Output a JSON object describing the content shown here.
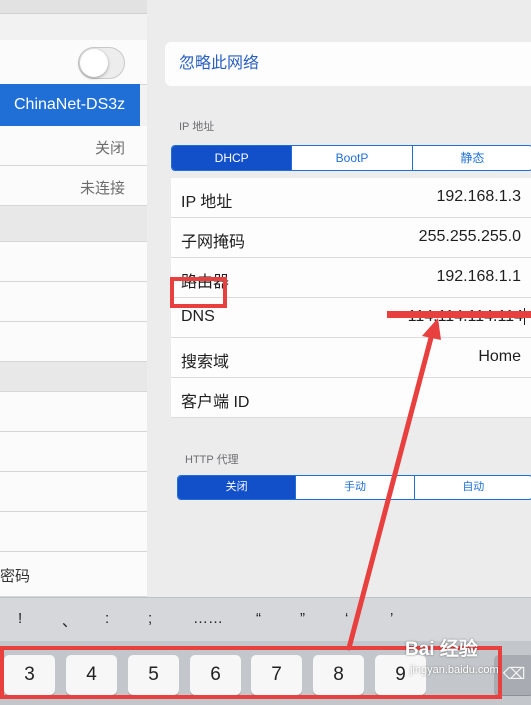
{
  "left_pane": {
    "selected_network": "ChinaNet-DS3z",
    "row1_value": "关闭",
    "row2_value": "未连接",
    "bottom_label": "密码"
  },
  "right_pane": {
    "forget_network": "忽略此网络",
    "ip_section_header": "IP 地址",
    "ip_modes": [
      "DHCP",
      "BootP",
      "静态"
    ],
    "fields": [
      {
        "label": "IP 地址",
        "value": "192.168.1.3"
      },
      {
        "label": "子网掩码",
        "value": "255.255.255.0"
      },
      {
        "label": "路由器",
        "value": "192.168.1.1"
      },
      {
        "label": "DNS",
        "value": "114.114.114.114"
      },
      {
        "label": "搜索域",
        "value": "Home"
      },
      {
        "label": "客户端 ID",
        "value": ""
      }
    ],
    "http_proxy_header": "HTTP 代理",
    "proxy_modes": [
      "关闭",
      "手动",
      "自动"
    ]
  },
  "keyboard": {
    "punctuation": [
      "!",
      "、",
      ":",
      ";",
      "……",
      "“",
      "”",
      "‘",
      "’"
    ],
    "number_keys": [
      "3",
      "4",
      "5",
      "6",
      "7",
      "8",
      "9"
    ]
  },
  "watermark": {
    "brand": "Bai 经验",
    "url": "jingyan.baidu.com"
  },
  "colors": {
    "accent": "#1f6fd6",
    "highlight": "#e8403f"
  }
}
